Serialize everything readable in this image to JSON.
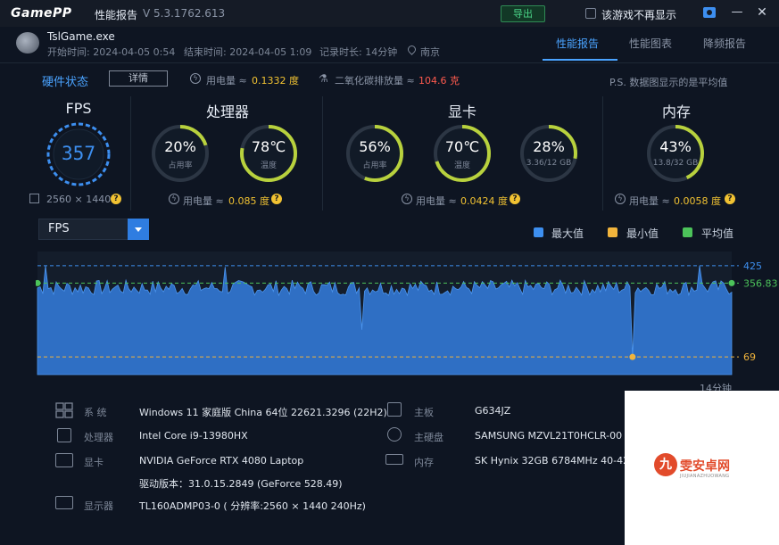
{
  "app": {
    "logo": "GamePP",
    "section": "性能报告",
    "version": "V 5.3.1762.613",
    "export_label": "导出",
    "no_show_label": "该游戏不再显示",
    "minimize_glyph": "—",
    "close_glyph": "✕"
  },
  "session": {
    "game": "TslGame.exe",
    "start": "开始时间: 2024-04-05 0:54",
    "end": "结束时间: 2024-04-05 1:09",
    "duration": "记录时长: 14分钟",
    "location": "南京"
  },
  "tabs": [
    "性能报告",
    "性能图表",
    "降频报告"
  ],
  "active_tab": 0,
  "hardware": {
    "title": "硬件状态",
    "detail_button": "详情",
    "power_label": "用电量 ≈",
    "power_value": "0.1332 度",
    "co2_label": "二氧化碳排放量 ≈",
    "co2_value": "104.6 克",
    "ps_note": "P.S. 数据图显示的是平均值"
  },
  "sections": {
    "fps": {
      "title": "FPS",
      "value": "357",
      "resolution": "2560 × 1440"
    },
    "cpu": {
      "title": "处理器",
      "usage": {
        "value": "20%",
        "label": "占用率",
        "fraction": 0.2
      },
      "temp": {
        "value": "78℃",
        "label": "温度",
        "fraction": 0.78
      },
      "power_label": "用电量 ≈",
      "power_value": "0.085 度"
    },
    "gpu": {
      "title": "显卡",
      "usage": {
        "value": "56%",
        "label": "占用率",
        "fraction": 0.56
      },
      "temp": {
        "value": "70℃",
        "label": "温度",
        "fraction": 0.7
      },
      "vram": {
        "value": "28%",
        "label": "3.36/12 GB",
        "fraction": 0.28
      },
      "power_label": "用电量 ≈",
      "power_value": "0.0424 度"
    },
    "mem": {
      "title": "内存",
      "usage": {
        "value": "43%",
        "label": "13.8/32 GB",
        "fraction": 0.43
      },
      "power_label": "用电量 ≈",
      "power_value": "0.0058 度"
    }
  },
  "chart_select": {
    "value": "FPS"
  },
  "legend": [
    {
      "name": "最大值",
      "color": "#3d8ff0"
    },
    {
      "name": "最小值",
      "color": "#f1b43c"
    },
    {
      "name": "平均值",
      "color": "#4cc35a"
    }
  ],
  "chart_data": {
    "type": "area",
    "metric": "FPS",
    "max": 425,
    "min": 69,
    "avg": 356.83,
    "ylim": [
      0,
      480
    ],
    "duration_label": "14分钟",
    "series_color": "#3d8ff0"
  },
  "specs": {
    "system_key": "系  统",
    "system_val": "Windows 11 家庭版 China 64位 22621.3296 (22H2)",
    "cpu_key": "处理器",
    "cpu_val": "Intel Core i9-13980HX",
    "gpu_key": "显卡",
    "gpu_val": "NVIDIA GeForce RTX 4080 Laptop",
    "driver_val": "驱动版本：31.0.15.2849 (GeForce 528.49)",
    "display_key": "显示器",
    "display_val": "TL160ADMP03-0 ( 分辨率:2560 × 1440 240Hz)",
    "board_key": "主板",
    "board_val": "G634JZ",
    "disk_key": "主硬盘",
    "disk_val": "SAMSUNG MZVL21T0HCLR-00",
    "ram_key": "内存",
    "ram_val": "SK Hynix 32GB 6784MHz 40-42"
  },
  "watermark": {
    "logo_char": "九",
    "text": "雯安卓网",
    "sub": "JIUJIANAZHUOWANG"
  }
}
